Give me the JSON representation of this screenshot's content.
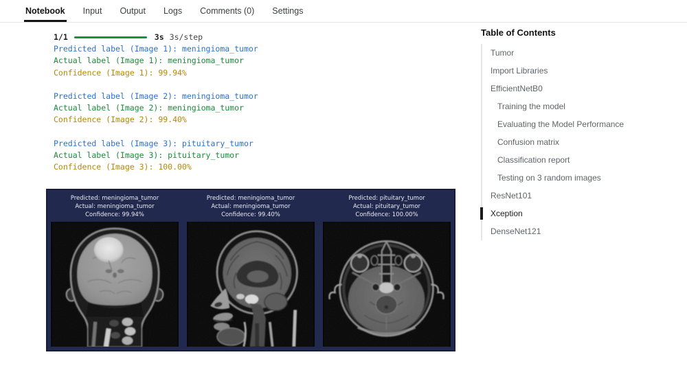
{
  "tabs": [
    {
      "label": "Notebook",
      "active": true
    },
    {
      "label": "Input",
      "active": false
    },
    {
      "label": "Output",
      "active": false
    },
    {
      "label": "Logs",
      "active": false
    },
    {
      "label": "Comments (0)",
      "active": false
    },
    {
      "label": "Settings",
      "active": false
    }
  ],
  "output": {
    "progress": {
      "steps": "1/1",
      "time": "3s",
      "per_step": "3s/step"
    },
    "blocks": [
      {
        "predicted": "Predicted label (Image 1): meningioma_tumor",
        "actual": "Actual label (Image 1): meningioma_tumor",
        "confidence": "Confidence (Image 1): 99.94%"
      },
      {
        "predicted": "Predicted label (Image 2): meningioma_tumor",
        "actual": "Actual label (Image 2): meningioma_tumor",
        "confidence": "Confidence (Image 2): 99.40%"
      },
      {
        "predicted": "Predicted label (Image 3): pituitary_tumor",
        "actual": "Actual label (Image 3): pituitary_tumor",
        "confidence": "Confidence (Image 3): 100.00%"
      }
    ]
  },
  "figure": {
    "panels": [
      {
        "predicted": "Predicted: meningioma_tumor",
        "actual": "Actual: meningioma_tumor",
        "confidence": "Confidence: 99.94%",
        "view": "coronal-brain-mri"
      },
      {
        "predicted": "Predicted: meningioma_tumor",
        "actual": "Actual: meningioma_tumor",
        "confidence": "Confidence: 99.40%",
        "view": "sagittal-brain-mri"
      },
      {
        "predicted": "Predicted: pituitary_tumor",
        "actual": "Actual: pituitary_tumor",
        "confidence": "Confidence: 100.00%",
        "view": "axial-brain-mri"
      }
    ]
  },
  "toc": {
    "title": "Table of Contents",
    "items": [
      {
        "label": "Tumor",
        "level": 1,
        "active": false
      },
      {
        "label": "Import Libraries",
        "level": 1,
        "active": false
      },
      {
        "label": "EfficientNetB0",
        "level": 1,
        "active": false
      },
      {
        "label": "Training the model",
        "level": 2,
        "active": false
      },
      {
        "label": "Evaluating the Model Performance",
        "level": 2,
        "active": false
      },
      {
        "label": "Confusion matrix",
        "level": 2,
        "active": false
      },
      {
        "label": "Classification report",
        "level": 2,
        "active": false
      },
      {
        "label": "Testing on 3 random images",
        "level": 2,
        "active": false
      },
      {
        "label": "ResNet101",
        "level": 1,
        "active": false
      },
      {
        "label": "Xception",
        "level": 1,
        "active": true
      },
      {
        "label": "DenseNet121",
        "level": 1,
        "active": false
      }
    ]
  },
  "colors": {
    "ansi_blue": "#2a71d0",
    "ansi_green": "#1a8b3a",
    "ansi_yellow": "#b58900",
    "progress_green": "#17913c",
    "figure_bg": "#212a4e",
    "figure_border": "#171d38",
    "active_tab_underline": "#141414",
    "toc_active": "#1c1c1c"
  }
}
